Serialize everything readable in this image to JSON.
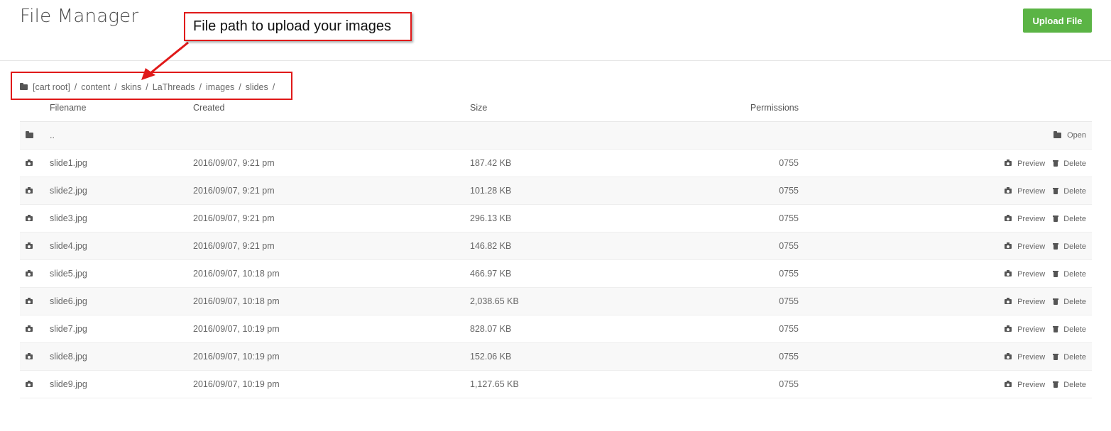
{
  "header": {
    "title": "File Manager",
    "upload_label": "Upload File",
    "upload_color": "#5bb445"
  },
  "annotation": {
    "text": "File path to upload your images",
    "color": "#e01919"
  },
  "breadcrumb": {
    "icon": "folder-icon",
    "items": [
      "[cart root]",
      "content",
      "skins",
      "LaThreads",
      "images",
      "slides"
    ],
    "separator": "/"
  },
  "table": {
    "headers": {
      "filename": "Filename",
      "created": "Created",
      "size": "Size",
      "permissions": "Permissions"
    },
    "parent_row": {
      "name": "..",
      "icon": "folder-icon",
      "action_label": "Open"
    },
    "actions": {
      "preview": "Preview",
      "delete": "Delete"
    },
    "rows": [
      {
        "name": "slide1.jpg",
        "created": "2016/09/07, 9:21 pm",
        "size": "187.42 KB",
        "perm": "0755"
      },
      {
        "name": "slide2.jpg",
        "created": "2016/09/07, 9:21 pm",
        "size": "101.28 KB",
        "perm": "0755"
      },
      {
        "name": "slide3.jpg",
        "created": "2016/09/07, 9:21 pm",
        "size": "296.13 KB",
        "perm": "0755"
      },
      {
        "name": "slide4.jpg",
        "created": "2016/09/07, 9:21 pm",
        "size": "146.82 KB",
        "perm": "0755"
      },
      {
        "name": "slide5.jpg",
        "created": "2016/09/07, 10:18 pm",
        "size": "466.97 KB",
        "perm": "0755"
      },
      {
        "name": "slide6.jpg",
        "created": "2016/09/07, 10:18 pm",
        "size": "2,038.65 KB",
        "perm": "0755"
      },
      {
        "name": "slide7.jpg",
        "created": "2016/09/07, 10:19 pm",
        "size": "828.07 KB",
        "perm": "0755"
      },
      {
        "name": "slide8.jpg",
        "created": "2016/09/07, 10:19 pm",
        "size": "152.06 KB",
        "perm": "0755"
      },
      {
        "name": "slide9.jpg",
        "created": "2016/09/07, 10:19 pm",
        "size": "1,127.65 KB",
        "perm": "0755"
      }
    ]
  }
}
